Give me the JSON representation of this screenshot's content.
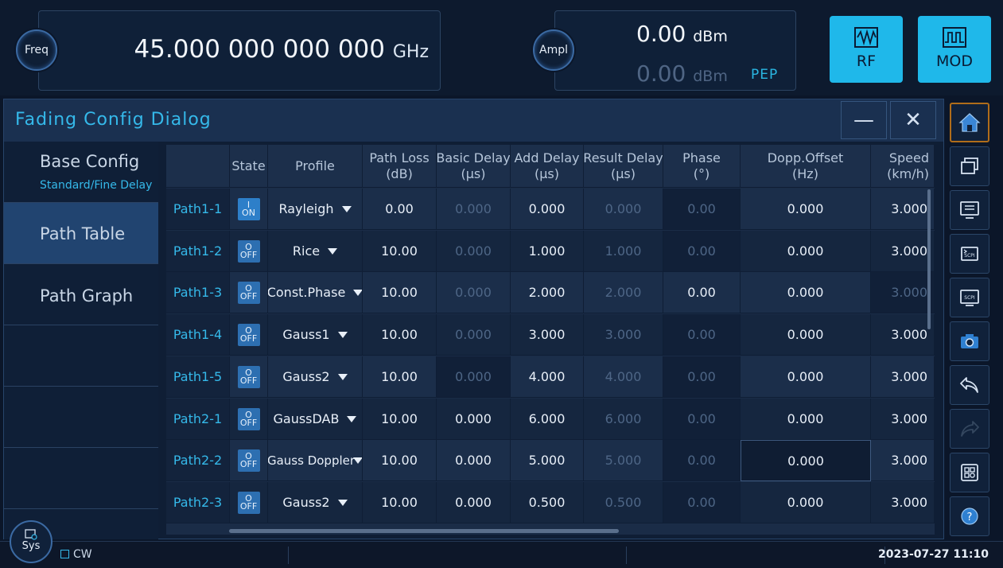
{
  "top": {
    "freq_button": "Freq",
    "freq_value": "45.000 000 000 000",
    "freq_unit": "GHz",
    "ampl_button": "Ampl",
    "ampl_value": "0.00",
    "ampl_unit": "dBm",
    "pep_value": "0.00",
    "pep_unit": "dBm",
    "pep_label": "PEP",
    "rf_label": "RF",
    "mod_label": "MOD"
  },
  "dialog": {
    "title": "Fading Config Dialog",
    "minimize": "—",
    "close": "✕"
  },
  "menu": {
    "base_config": "Base Config",
    "base_config_sub": "Standard/Fine Delay",
    "path_table": "Path Table",
    "path_graph": "Path Graph"
  },
  "table": {
    "headers": {
      "state": "State",
      "profile": "Profile",
      "path_loss_1": "Path Loss",
      "path_loss_2": "(dB)",
      "basic_delay_1": "Basic Delay",
      "basic_delay_2": "(µs)",
      "add_delay_1": "Add Delay",
      "add_delay_2": "(µs)",
      "result_delay_1": "Result Delay",
      "result_delay_2": "(µs)",
      "phase_1": "Phase",
      "phase_2": "(°)",
      "dopp_1": "Dopp.Offset",
      "dopp_2": "(Hz)",
      "speed_1": "Speed",
      "speed_2": "(km/h)"
    },
    "rows": [
      {
        "name": "Path1-1",
        "state_top": "I",
        "state": "ON",
        "profile": "Rayleigh",
        "loss": "0.00",
        "basic": "0.000",
        "add": "0.000",
        "result": "0.000",
        "phase": "0.00",
        "dopp": "0.000",
        "speed": "3.000"
      },
      {
        "name": "Path1-2",
        "state_top": "O",
        "state": "OFF",
        "profile": "Rice",
        "loss": "10.00",
        "basic": "0.000",
        "add": "1.000",
        "result": "1.000",
        "phase": "0.00",
        "dopp": "0.000",
        "speed": "3.000"
      },
      {
        "name": "Path1-3",
        "state_top": "O",
        "state": "OFF",
        "profile": "Const.Phase",
        "loss": "10.00",
        "basic": "0.000",
        "add": "2.000",
        "result": "2.000",
        "phase": "0.00",
        "dopp": "0.000",
        "speed": "3.000"
      },
      {
        "name": "Path1-4",
        "state_top": "O",
        "state": "OFF",
        "profile": "Gauss1",
        "loss": "10.00",
        "basic": "0.000",
        "add": "3.000",
        "result": "3.000",
        "phase": "0.00",
        "dopp": "0.000",
        "speed": "3.000"
      },
      {
        "name": "Path1-5",
        "state_top": "O",
        "state": "OFF",
        "profile": "Gauss2",
        "loss": "10.00",
        "basic": "0.000",
        "add": "4.000",
        "result": "4.000",
        "phase": "0.00",
        "dopp": "0.000",
        "speed": "3.000"
      },
      {
        "name": "Path2-1",
        "state_top": "O",
        "state": "OFF",
        "profile": "GaussDAB",
        "loss": "10.00",
        "basic": "0.000",
        "add": "6.000",
        "result": "6.000",
        "phase": "0.00",
        "dopp": "0.000",
        "speed": "3.000"
      },
      {
        "name": "Path2-2",
        "state_top": "O",
        "state": "OFF",
        "profile": "Gauss Doppler",
        "loss": "10.00",
        "basic": "0.000",
        "add": "5.000",
        "result": "5.000",
        "phase": "0.00",
        "dopp": "0.000",
        "speed": "3.000"
      },
      {
        "name": "Path2-3",
        "state_top": "O",
        "state": "OFF",
        "profile": "Gauss2",
        "loss": "10.00",
        "basic": "0.000",
        "add": "0.500",
        "result": "0.500",
        "phase": "0.00",
        "dopp": "0.000",
        "speed": "3.000"
      }
    ]
  },
  "toolbar": {
    "icons": [
      "home-icon",
      "windows-icon",
      "monitor-checklist-icon",
      "scpi-terminal-icon",
      "scpi-monitor-icon",
      "camera-icon",
      "undo-icon",
      "redo-icon",
      "layout-icon",
      "help-icon"
    ]
  },
  "status": {
    "sys_label": "Sys",
    "mode": "CW",
    "datetime": "2023-07-27 11:10"
  },
  "colors": {
    "accent": "#35b9ea",
    "key_bg": "#1fb8ea",
    "background": "#0b1629"
  }
}
